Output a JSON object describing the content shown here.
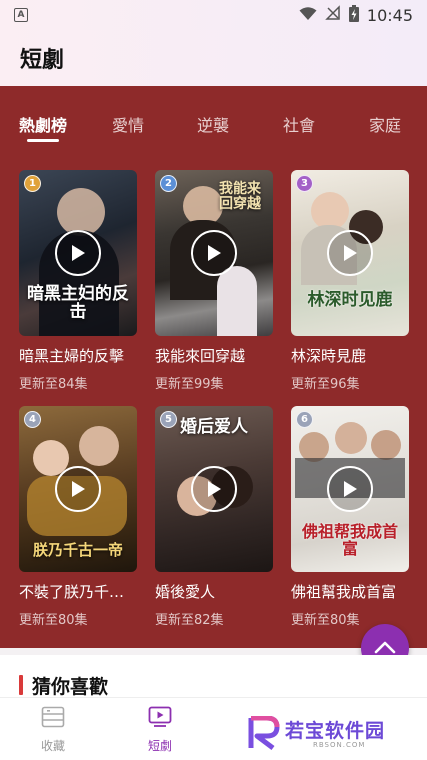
{
  "status": {
    "time": "10:45",
    "notif": "A"
  },
  "header": {
    "title": "短劇"
  },
  "tabs": [
    {
      "label": "熱劇榜",
      "active": true
    },
    {
      "label": "愛情",
      "active": false
    },
    {
      "label": "逆襲",
      "active": false
    },
    {
      "label": "社會",
      "active": false
    },
    {
      "label": "家庭",
      "active": false
    }
  ],
  "dramas": [
    {
      "rank": "1",
      "title": "暗黑主婦的反擊",
      "update": "更新至84集",
      "poster_text": "暗黑主妇的反击",
      "rank_color": "#e0a23a"
    },
    {
      "rank": "2",
      "title": "我能來回穿越",
      "update": "更新至99集",
      "poster_text": "我能来回穿越",
      "rank_color": "#5b8fd6"
    },
    {
      "rank": "3",
      "title": "林深時見鹿",
      "update": "更新至96集",
      "poster_text": "林深时见鹿",
      "rank_color": "#a360c7"
    },
    {
      "rank": "4",
      "title": "不裝了朕乃千古一帝",
      "update": "更新至80集",
      "poster_text": "朕乃千古一帝",
      "rank_color": "#9aa3b8"
    },
    {
      "rank": "5",
      "title": "婚後愛人",
      "update": "更新至82集",
      "poster_text": "婚后爱人",
      "rank_color": "#9aa3b8"
    },
    {
      "rank": "6",
      "title": "佛祖幫我成首富",
      "update": "更新至80集",
      "poster_text": "佛祖帮我成首富",
      "rank_color": "#9aa3b8"
    }
  ],
  "section": {
    "title": "猜你喜歡"
  },
  "nav": {
    "favorites": "收藏",
    "short_drama": "短劇"
  },
  "watermark": {
    "text": "若宝软件园",
    "sub": "RBSON.COM"
  },
  "colors": {
    "panel": "#8e2a2a",
    "accent": "#8c2fb0",
    "section_bar": "#d93a3a"
  }
}
